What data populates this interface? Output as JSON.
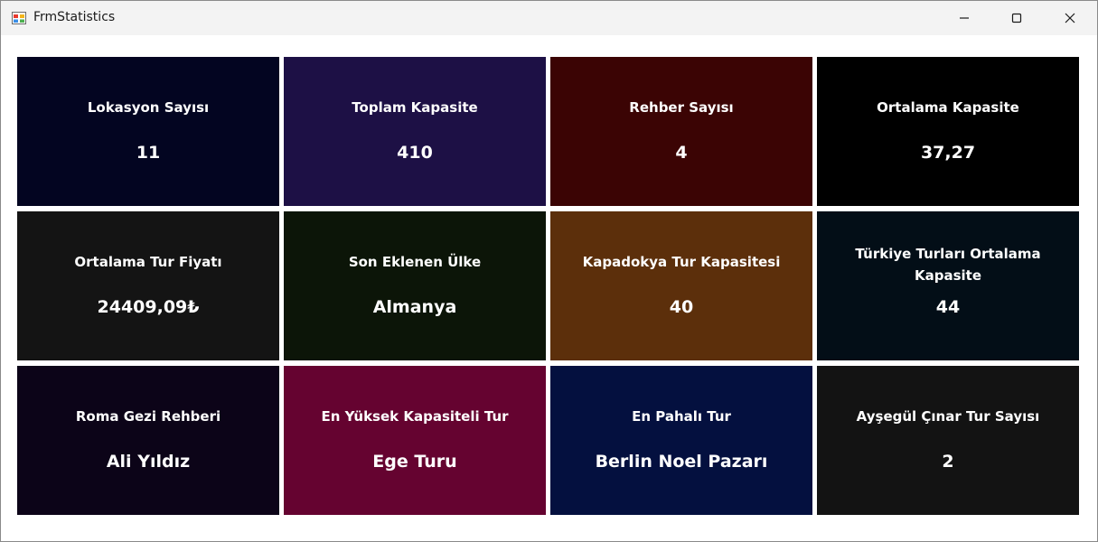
{
  "window": {
    "title": "FrmStatistics",
    "icon": "app-form-icon",
    "controls": {
      "minimize_icon": "minimize-icon",
      "maximize_icon": "maximize-icon",
      "close_icon": "close-icon"
    }
  },
  "tiles": [
    {
      "label": "Lokasyon Sayısı",
      "value": "11",
      "color": "#030521"
    },
    {
      "label": "Toplam Kapasite",
      "value": "410",
      "color": "#1d1045"
    },
    {
      "label": "Rehber Sayısı",
      "value": "4",
      "color": "#3b0404"
    },
    {
      "label": "Ortalama Kapasite",
      "value": "37,27",
      "color": "#000000"
    },
    {
      "label": "Ortalama Tur Fiyatı",
      "value": "24409,09₺",
      "color": "#141414"
    },
    {
      "label": "Son Eklenen Ülke",
      "value": "Almanya",
      "color": "#0c1508"
    },
    {
      "label": "Kapadokya Tur Kapasitesi",
      "value": "40",
      "color": "#5c2f0b"
    },
    {
      "label": "Türkiye Turları Ortalama Kapasite",
      "value": "44",
      "color": "#030e17"
    },
    {
      "label": "Roma Gezi Rehberi",
      "value": "Ali Yıldız",
      "color": "#0c0418"
    },
    {
      "label": "En Yüksek Kapasiteli Tur",
      "value": "Ege Turu",
      "color": "#650330"
    },
    {
      "label": "En Pahalı Tur",
      "value": "Berlin Noel Pazarı",
      "color": "#04103f"
    },
    {
      "label": "Ayşegül Çınar Tur Sayısı",
      "value": "2",
      "color": "#131313"
    }
  ]
}
